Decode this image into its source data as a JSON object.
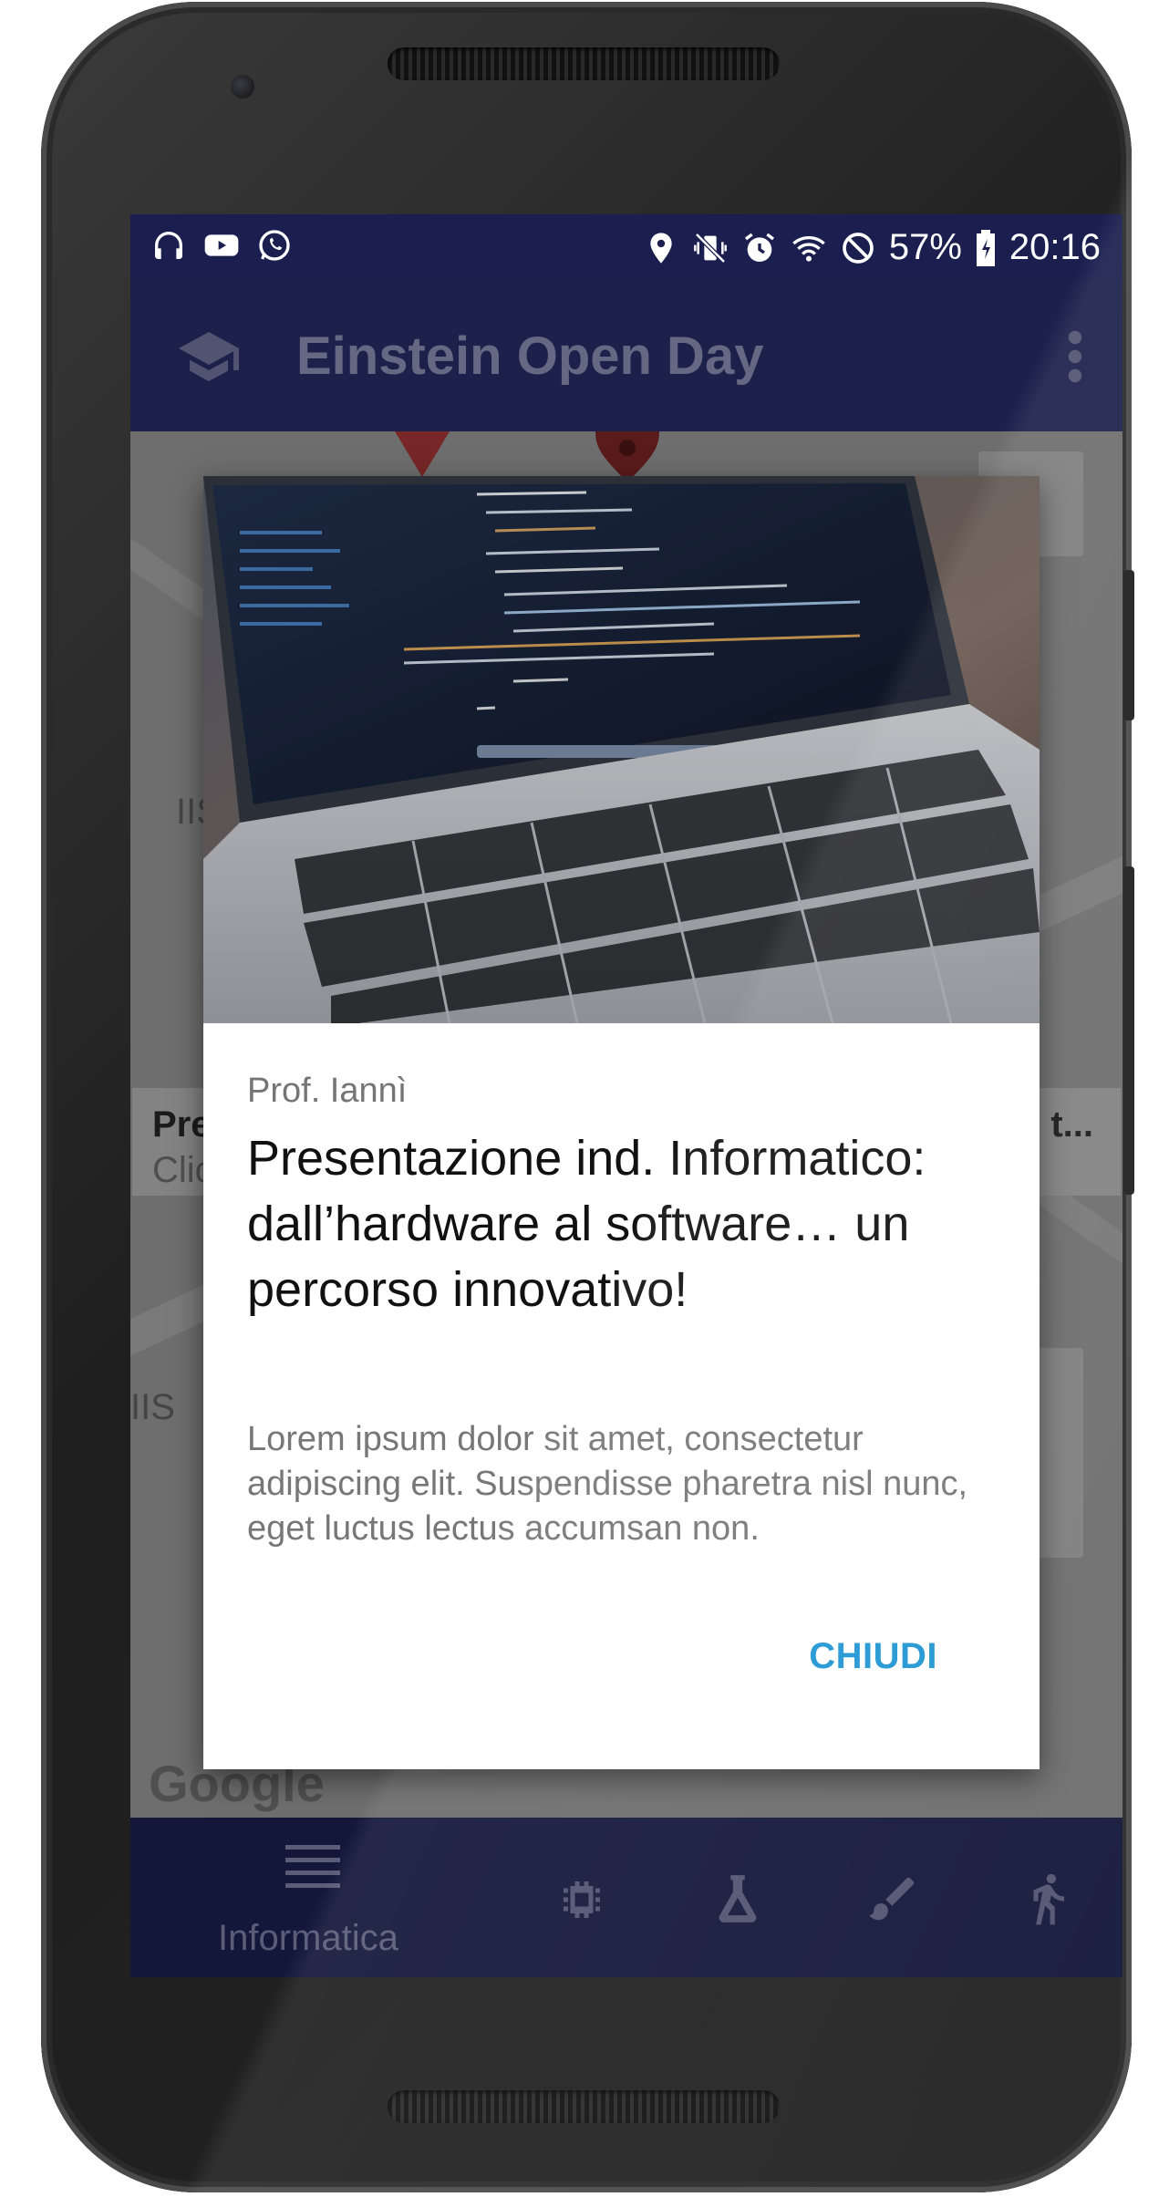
{
  "status_bar": {
    "battery": "57%",
    "time": "20:16",
    "left_icons": [
      "headphones-icon",
      "youtube-icon",
      "whatsapp-icon"
    ],
    "right_icons": [
      "location-icon",
      "vibrate-icon",
      "alarm-icon",
      "wifi-icon",
      "do-not-disturb-icon",
      "battery-icon"
    ]
  },
  "app_bar": {
    "title": "Einstein Open Day",
    "nav_icon": "school-icon",
    "menu_icon": "more-vert-icon"
  },
  "map": {
    "logo": "Google"
  },
  "dialog": {
    "author": "Prof. Iannì",
    "title": "Presentazione ind. Informatico: dall’hardware al software… un percorso innovativo!",
    "body": "Lorem ipsum dolor sit amet, consectetur adipiscing elit. Suspendisse pharetra nisl nunc, eget luctus lectus accumsan non.",
    "close_label": "CHIUDI",
    "image": "laptop-code-photo"
  },
  "bottom_nav": {
    "items": [
      {
        "icon": "list-icon",
        "label": "Informatica",
        "active": true
      },
      {
        "icon": "chip-icon",
        "label": ""
      },
      {
        "icon": "flask-icon",
        "label": ""
      },
      {
        "icon": "brush-icon",
        "label": ""
      },
      {
        "icon": "run-icon",
        "label": ""
      }
    ]
  },
  "colors": {
    "primary": "#2b3376",
    "status_bar": "#1a1f4f",
    "accent": "#2196d3"
  }
}
